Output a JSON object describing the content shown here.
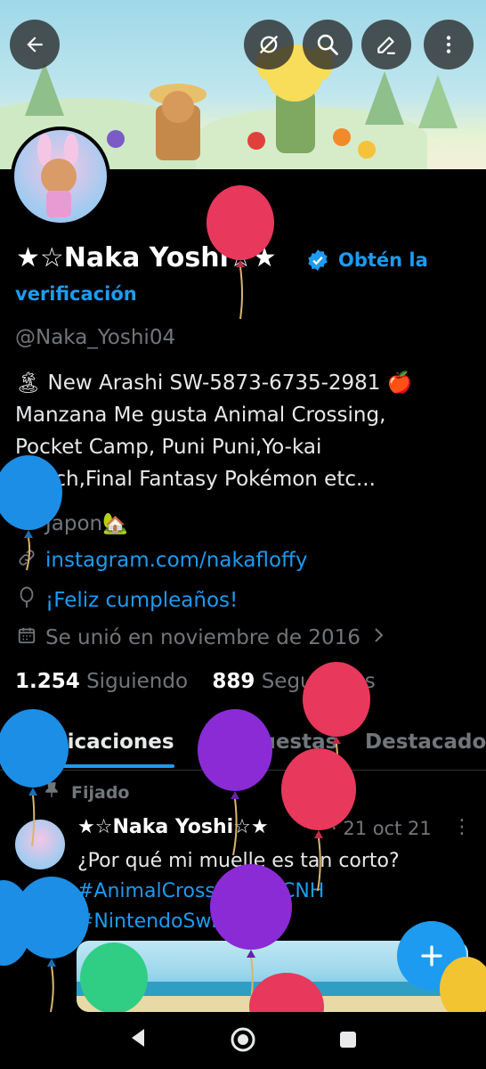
{
  "profile": {
    "name": "★☆Naka Yoshi☆★",
    "get_verified_1": "Obtén la",
    "get_verified_2": "verificación",
    "handle": "@Naka_Yoshi04",
    "bio_line1": "🏝 New Arashi SW-5873-6735-2981 🍎",
    "bio_line2": "Manzana Me gusta Animal Crossing,",
    "bio_line3": "Pocket Camp, Puni Puni,Yo-kai",
    "bio_line4": "Watch,Final Fantasy Pokémon etc...",
    "location": "Japon🏡",
    "website": "instagram.com/nakafloffy",
    "birthday": "¡Feliz cumpleaños!",
    "joined": "Se unió en noviembre de 2016",
    "following_count": "1.254",
    "following_label": "Siguiendo",
    "followers_count": "889",
    "followers_label": "Seguidores"
  },
  "tabs": {
    "posts": "Publicaciones",
    "replies": "Respuestas",
    "highlights": "Destacados"
  },
  "tweet": {
    "pinned_label": "Fijado",
    "author": "★☆Naka Yoshi☆★",
    "date": "· 21 oct 21",
    "text": "¿Por qué mi muelle es tan corto?",
    "hashtags_line1": "#AnimalCrossing #ACNH",
    "hashtags_line2": "#NintendoSwitch"
  },
  "icons": {
    "back": "arrow-left-icon",
    "hide": "eye-slash-icon",
    "search": "search-icon",
    "edit": "pencil-icon",
    "more": "more-vertical-icon",
    "compose": "plus-icon"
  },
  "colors": {
    "accent": "#1d9bf0",
    "background": "#000000",
    "muted": "#71767b"
  }
}
